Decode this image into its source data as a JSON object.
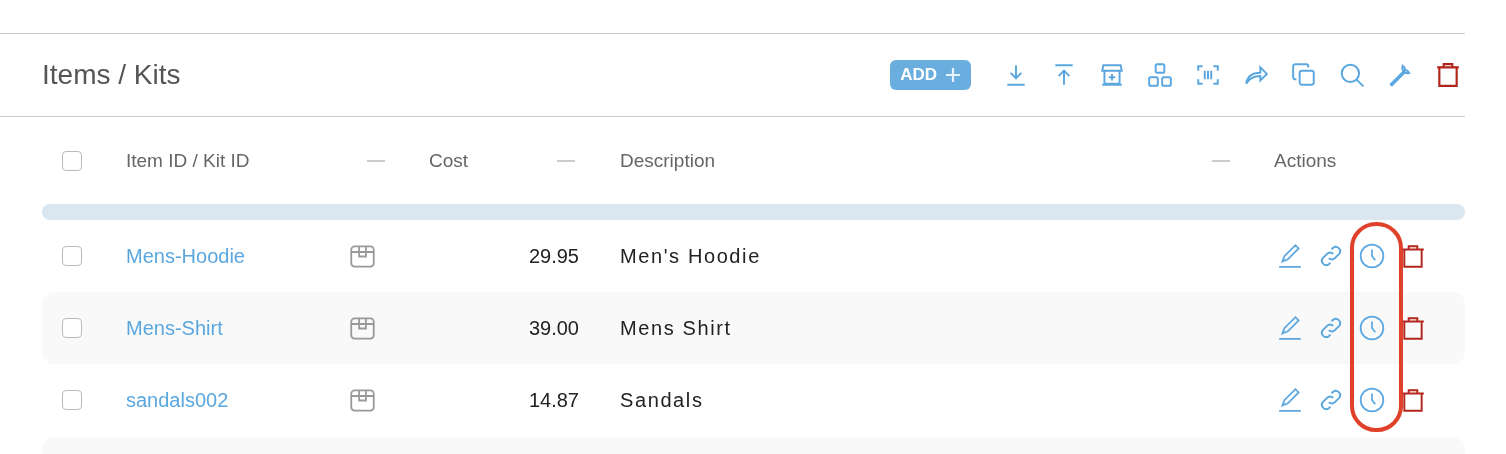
{
  "page": {
    "title": "Items / Kits"
  },
  "toolbar": {
    "add_label": "ADD"
  },
  "table": {
    "columns": [
      "Item ID / Kit ID",
      "Cost",
      "Description",
      "Actions"
    ],
    "select_all": {
      "checked": false
    },
    "rows": [
      {
        "item_id": "Mens-Hoodie",
        "cost": "29.95",
        "description": "Men's Hoodie",
        "checked": false
      },
      {
        "item_id": "Mens-Shirt",
        "cost": "39.00",
        "description": "Mens Shirt",
        "checked": false
      },
      {
        "item_id": "sandals002",
        "cost": "14.87",
        "description": "Sandals",
        "checked": false
      }
    ]
  }
}
